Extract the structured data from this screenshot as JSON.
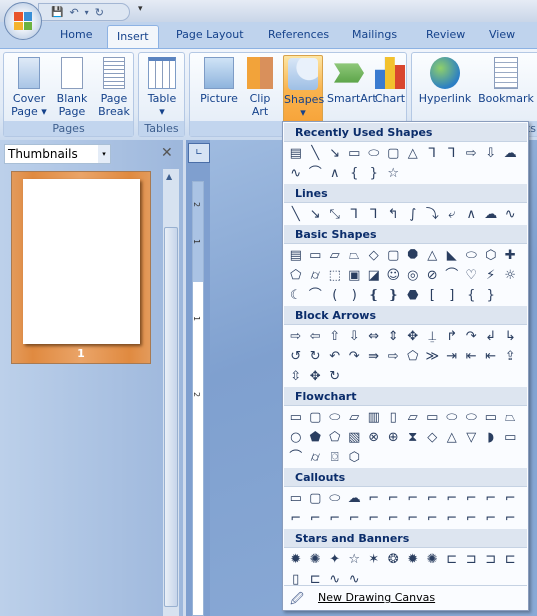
{
  "quick_access": {
    "save": "💾",
    "undo": "↶",
    "undo_more": "▾",
    "redo": "↻",
    "customize": "▾"
  },
  "tabs": [
    "Home",
    "Insert",
    "Page Layout",
    "References",
    "Mailings",
    "Review",
    "View"
  ],
  "active_tab": "Insert",
  "groups": {
    "pages": {
      "label": "Pages",
      "buttons": [
        "Cover\nPage ▾",
        "Blank\nPage",
        "Page\nBreak"
      ]
    },
    "tables": {
      "label": "Tables",
      "buttons": [
        "Table\n▾"
      ]
    },
    "illustrations": {
      "label": "Il",
      "buttons": [
        "Picture",
        "Clip\nArt",
        "Shapes\n▾",
        "SmartArt",
        "Chart"
      ]
    },
    "links": {
      "label": "ks",
      "buttons": [
        "Hyperlink",
        "Bookmark"
      ]
    }
  },
  "left_pane": {
    "view": "Thumbnails",
    "dropdown": "▾",
    "close": "✕",
    "page_number": "1"
  },
  "ruler": {
    "tab_stop": "∟",
    "labels": [
      "2",
      "1",
      "1",
      "2"
    ]
  },
  "shapes_menu": {
    "sections": [
      {
        "title": "Recently Used Shapes",
        "rows": [
          "▤╲↘▭⬭▢△⅂⅂⇨⇩☁",
          "∿⌒∧{}☆"
        ]
      },
      {
        "title": "Lines",
        "rows": [
          "╲↘⤡⅂⅂↰∫⤵⤶∧☁∿"
        ]
      },
      {
        "title": "Basic Shapes",
        "rows": [
          "▤▭▱⏢◇▢⯃△◣⬭⬡✚",
          "⬠⌭⬚▣◪☺◎⊘⌒♡⚡☼",
          "☾⌒()❴❵⬣[]{}"
        ]
      },
      {
        "title": "Block Arrows",
        "rows": [
          "⇨⇦⇧⇩⇔⇕✥⍊↱↷↲↳",
          "↺↻↶↷⇛⇨⬠≫⇥⇤⇤⇪",
          "⇳✥↻"
        ]
      },
      {
        "title": "Flowchart",
        "rows": [
          "▭▢⬭▱▥▯▱▭⬭⬭▭⏢",
          "○⬟⬠▧⊗⊕⧗◇△▽◗▭",
          "⌒⌭⌼⬡"
        ]
      },
      {
        "title": "Callouts",
        "rows": [
          "▭▢⬭☁⌐⌐⌐⌐⌐⌐⌐⌐",
          "⌐⌐⌐⌐⌐⌐⌐⌐⌐⌐⌐⌐"
        ]
      },
      {
        "title": "Stars and Banners",
        "rows": [
          "✹✺✦☆✶❂✹✺⊏⊐⊐⊏",
          "▯⊏∿∿"
        ]
      }
    ],
    "footer": {
      "icon": "🖉",
      "label": "New Drawing Canvas"
    }
  }
}
